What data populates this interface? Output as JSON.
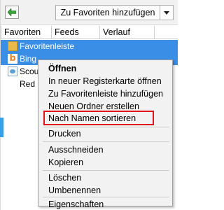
{
  "toolbar": {
    "pin_icon": "green-arrow-icon",
    "add_button_label": "Zu Favoriten hinzufügen",
    "dropdown_icon": "triangle-down-icon"
  },
  "tabs": [
    "Favoriten",
    "Feeds",
    "Verlauf"
  ],
  "tree": {
    "items": [
      {
        "label": "Favoritenleiste",
        "icon": "folder-icon",
        "selected": true
      },
      {
        "label": "Bing",
        "icon": "bing-icon",
        "selected": true
      },
      {
        "label": "Scou",
        "icon": "page-icon",
        "selected": false
      },
      {
        "label": "Red",
        "icon": "",
        "selected": false
      }
    ]
  },
  "context_menu": {
    "items": [
      {
        "label": "Öffnen",
        "bold": true
      },
      {
        "label": "In neuer Registerkarte öffnen"
      },
      {
        "label": "Zu Favoritenleiste hinzufügen"
      },
      {
        "label": "Neuen Ordner erstellen"
      },
      {
        "label": "Nach Namen sortieren",
        "highlighted": true
      },
      {
        "label": "Drucken"
      },
      {
        "label": "Ausschneiden"
      },
      {
        "label": "Kopieren"
      },
      {
        "label": "Löschen"
      },
      {
        "label": "Umbenennen"
      },
      {
        "label": "Eigenschaften"
      }
    ]
  },
  "colors": {
    "selection": "#3b8ee6",
    "highlight_box": "#e0141c",
    "menu_background": "#f2f2f2"
  }
}
